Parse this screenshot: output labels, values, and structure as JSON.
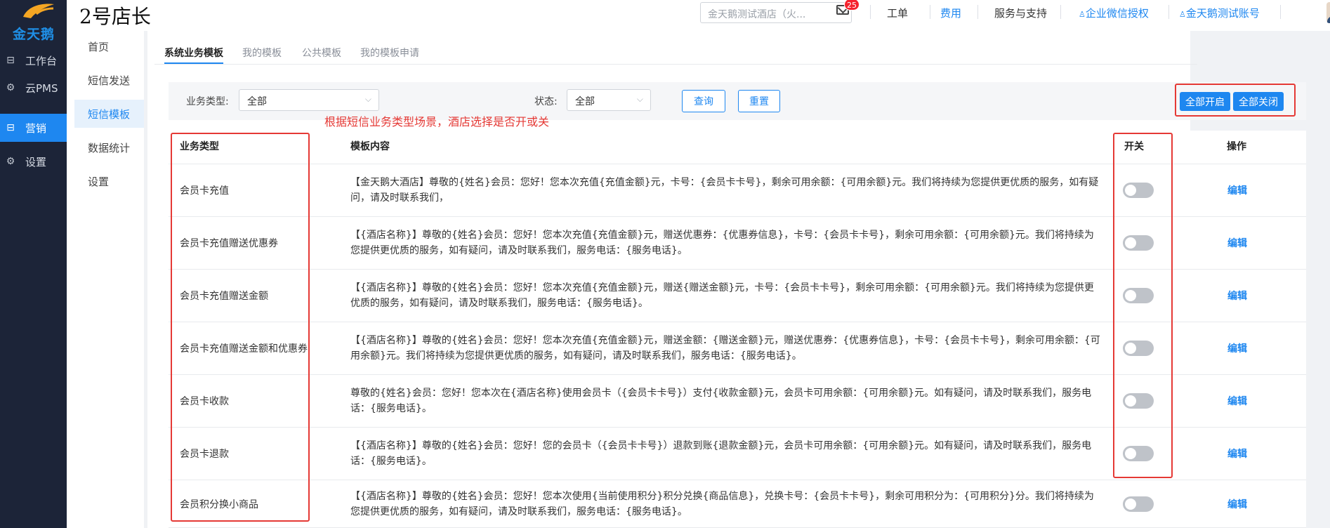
{
  "brand": {
    "logo_text": "金天鹅",
    "accent": "#1e87f0"
  },
  "sidebar": {
    "items": [
      {
        "label": "工作台",
        "icon": "workbench-icon"
      },
      {
        "label": "云PMS",
        "icon": "settings-gear-icon"
      },
      {
        "label": "营销",
        "icon": "marketing-icon",
        "active": true
      },
      {
        "label": "设置",
        "icon": "settings-gear-icon"
      }
    ]
  },
  "subnav": {
    "items": [
      {
        "label": "首页"
      },
      {
        "label": "短信发送"
      },
      {
        "label": "短信模板",
        "active": true
      },
      {
        "label": "数据统计"
      },
      {
        "label": "设置"
      }
    ]
  },
  "topbar": {
    "store_title": "2号店长",
    "hotel_select_value": "金天鹅测试酒店（火...",
    "mail_badge": "25",
    "links": {
      "ticket": "工单",
      "fees": "费用",
      "service": "服务与支持",
      "wechat_auth": "企业微信授权",
      "account": "金天鹅测试账号"
    }
  },
  "tabs": [
    {
      "label": "系统业务模板",
      "active": true
    },
    {
      "label": "我的模板"
    },
    {
      "label": "公共模板"
    },
    {
      "label": "我的模板申请"
    }
  ],
  "filter": {
    "type_label": "业务类型:",
    "type_value": "全部",
    "status_label": "状态:",
    "status_value": "全部",
    "query_button": "查询",
    "reset_button": "重置",
    "all_on_button": "全部开启",
    "all_off_button": "全部关闭"
  },
  "annotation": "根据短信业务类型场景，酒店选择是否开或关",
  "table": {
    "headers": {
      "type": "业务类型",
      "content": "模板内容",
      "switch": "开关",
      "action": "操作"
    },
    "edit_label": "编辑",
    "rows": [
      {
        "type": "会员卡充值",
        "content": "【金天鹅大酒店】尊敬的{姓名}会员：您好！您本次充值{充值金额}元，卡号：{会员卡卡号}，剩余可用余额：{可用余额}元。我们将持续为您提供更优质的服务，如有疑问，请及时联系我们，",
        "on": false
      },
      {
        "type": "会员卡充值赠送优惠券",
        "content": "【{酒店名称}】尊敬的{姓名}会员：您好！您本次充值{充值金额}元，赠送优惠券：{优惠券信息}，卡号：{会员卡卡号}，剩余可用余额：{可用余额}元。我们将持续为您提供更优质的服务，如有疑问，请及时联系我们，服务电话：{服务电话}。",
        "on": false
      },
      {
        "type": "会员卡充值赠送金额",
        "content": "【{酒店名称}】尊敬的{姓名}会员：您好！您本次充值{充值金额}元，赠送{赠送金额}元，卡号：{会员卡卡号}，剩余可用余额：{可用余额}元。我们将持续为您提供更优质的服务，如有疑问，请及时联系我们，服务电话：{服务电话}。",
        "on": false
      },
      {
        "type": "会员卡充值赠送金额和优惠券",
        "content": "【{酒店名称}】尊敬的{姓名}会员：您好！您本次充值{充值金额}元，赠送金额：{赠送金额}元，赠送优惠券：{优惠券信息}，卡号：{会员卡卡号}，剩余可用余额：{可用余额}元。我们将持续为您提供更优质的服务，如有疑问，请及时联系我们，服务电话：{服务电话}。",
        "on": false
      },
      {
        "type": "会员卡收款",
        "content": "尊敬的{姓名}会员：您好！您本次在{酒店名称}使用会员卡（{会员卡卡号}）支付{收款金额}元，会员卡可用余额：{可用余额}元。如有疑问，请及时联系我们，服务电话：{服务电话}。",
        "on": false
      },
      {
        "type": "会员卡退款",
        "content": "【{酒店名称}】尊敬的{姓名}会员：您好！您的会员卡（{会员卡卡号}）退款到账{退款金额}元，会员卡可用余额：{可用余额}元。如有疑问，请及时联系我们，服务电话：{服务电话}。",
        "on": false
      },
      {
        "type": "会员积分换小商品",
        "content": "【{酒店名称}】尊敬的{姓名}会员：您好！您本次使用{当前使用积分}积分兑换{商品信息}，兑换卡号：{会员卡卡号}，剩余可用积分为：{可用积分}分。我们将持续为您提供更优质的服务，如有疑问，请及时联系我们，服务电话：{服务电话}。",
        "on": false
      }
    ]
  }
}
